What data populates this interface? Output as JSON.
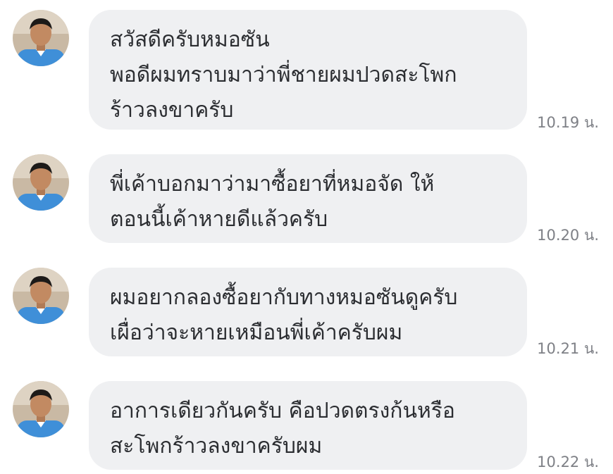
{
  "messages": [
    {
      "lines": [
        "สวัสดีครับหมอซัน",
        "พอดีผมทราบมาว่าพี่ชายผมปวดสะโพก",
        "ร้าวลงขาครับ"
      ],
      "time": "10.19 น."
    },
    {
      "lines": [
        "พี่เค้าบอกมาว่ามาซื้อยาที่หมอจัด ให้",
        "ตอนนี้เค้าหายดีแล้วครับ"
      ],
      "time": "10.20 น."
    },
    {
      "lines": [
        "ผมอยากลองซื้อยากับทางหมอซันดูครับ",
        "เผื่อว่าจะหายเหมือนพี่เค้าครับผม"
      ],
      "time": "10.21 น."
    },
    {
      "lines": [
        "อาการเดียวกันครับ  คือปวดตรงก้นหรือ",
        "สะโพกร้าวลงขาครับผม"
      ],
      "time": "10.22 น."
    }
  ],
  "colors": {
    "bubble": "#eff0f2",
    "text": "#2b2d31",
    "timestamp": "#7e8086",
    "shirt": "#3f8fd8"
  }
}
